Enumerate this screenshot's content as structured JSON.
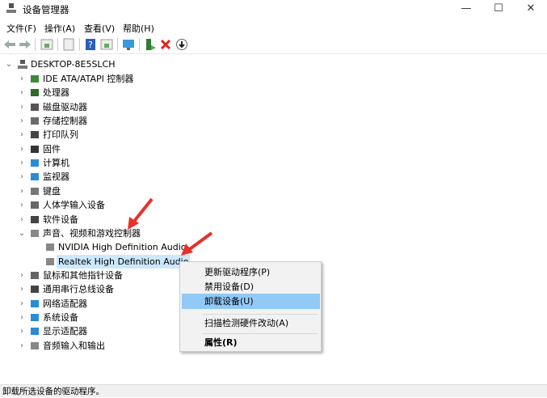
{
  "window": {
    "title": "设备管理器",
    "minimize": "—",
    "maximize": "☐",
    "close": "✕"
  },
  "menu": [
    "文件(F)",
    "操作(A)",
    "查看(V)",
    "帮助(H)"
  ],
  "toolbar": [
    "back-icon",
    "forward-icon",
    "show-hide-tree-icon",
    "properties-icon",
    "help-icon",
    "view-icon",
    "monitor-icon",
    "update-driver-icon",
    "uninstall-icon",
    "disable-icon"
  ],
  "tree": {
    "root": "DESKTOP-8E5SLCH",
    "items": [
      {
        "label": "IDE ATA/ATAPI 控制器",
        "level": 1,
        "state": "collapsed",
        "color": "#3a8a3a"
      },
      {
        "label": "处理器",
        "level": 1,
        "state": "collapsed",
        "color": "#2f6b2f"
      },
      {
        "label": "磁盘驱动器",
        "level": 1,
        "state": "collapsed",
        "color": "#555555"
      },
      {
        "label": "存储控制器",
        "level": 1,
        "state": "collapsed",
        "color": "#6a6a6a"
      },
      {
        "label": "打印队列",
        "level": 1,
        "state": "collapsed",
        "color": "#444444"
      },
      {
        "label": "固件",
        "level": 1,
        "state": "collapsed",
        "color": "#333333"
      },
      {
        "label": "计算机",
        "level": 1,
        "state": "collapsed",
        "color": "#2a8bd6"
      },
      {
        "label": "监视器",
        "level": 1,
        "state": "collapsed",
        "color": "#2a8bd6"
      },
      {
        "label": "键盘",
        "level": 1,
        "state": "collapsed",
        "color": "#777777"
      },
      {
        "label": "人体学输入设备",
        "level": 1,
        "state": "collapsed",
        "color": "#666666"
      },
      {
        "label": "软件设备",
        "level": 1,
        "state": "collapsed",
        "color": "#444444"
      },
      {
        "label": "声音、视频和游戏控制器",
        "level": 1,
        "state": "expanded",
        "color": "#888888"
      },
      {
        "label": "NVIDIA High Definition Audio",
        "level": 2,
        "state": "none",
        "color": "#888888"
      },
      {
        "label": "Realtek High Definition Audio",
        "level": 2,
        "state": "none",
        "color": "#888888",
        "selected": true
      },
      {
        "label": "鼠标和其他指针设备",
        "level": 1,
        "state": "collapsed",
        "color": "#666666"
      },
      {
        "label": "通用串行总线设备",
        "level": 1,
        "state": "collapsed",
        "color": "#444444"
      },
      {
        "label": "网络适配器",
        "level": 1,
        "state": "collapsed",
        "color": "#2a8bd6"
      },
      {
        "label": "系统设备",
        "level": 1,
        "state": "collapsed",
        "color": "#2a8bd6"
      },
      {
        "label": "显示适配器",
        "level": 1,
        "state": "collapsed",
        "color": "#2a8bd6"
      },
      {
        "label": "音频输入和输出",
        "level": 1,
        "state": "collapsed",
        "color": "#888888"
      }
    ]
  },
  "context_menu": {
    "items": [
      "更新驱动程序(P)",
      "禁用设备(D)",
      "卸载设备(U)",
      "扫描检测硬件改动(A)",
      "属性(R)"
    ],
    "highlighted": "卸载设备(U)"
  },
  "status": "卸载所选设备的驱动程序。",
  "colors": {
    "selection": "#cce8ff",
    "menu_highlight": "#91c9f7",
    "arrow": "#e8302a"
  }
}
